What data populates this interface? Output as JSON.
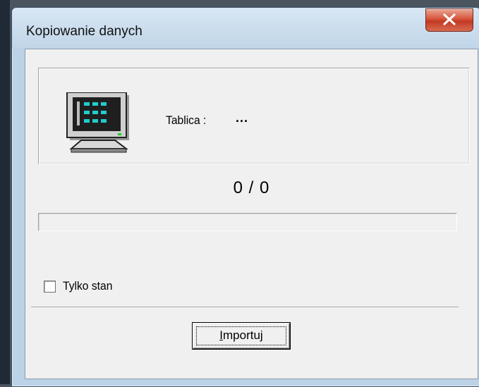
{
  "window": {
    "title": "Kopiowanie danych",
    "close_icon": "close-x-icon"
  },
  "info": {
    "icon": "computer-monitor-icon",
    "table_label": "Tablica :",
    "table_value": "..."
  },
  "progress": {
    "counter_text": "0 / 0",
    "fraction": 0
  },
  "options": {
    "only_stock_label": "Tylko stan",
    "only_stock_checked": false
  },
  "actions": {
    "import_mnemonic": "I",
    "import_rest": "mportuj"
  },
  "colors": {
    "close_button": "#c8442b",
    "dialog_background": "#f0f0f0"
  }
}
